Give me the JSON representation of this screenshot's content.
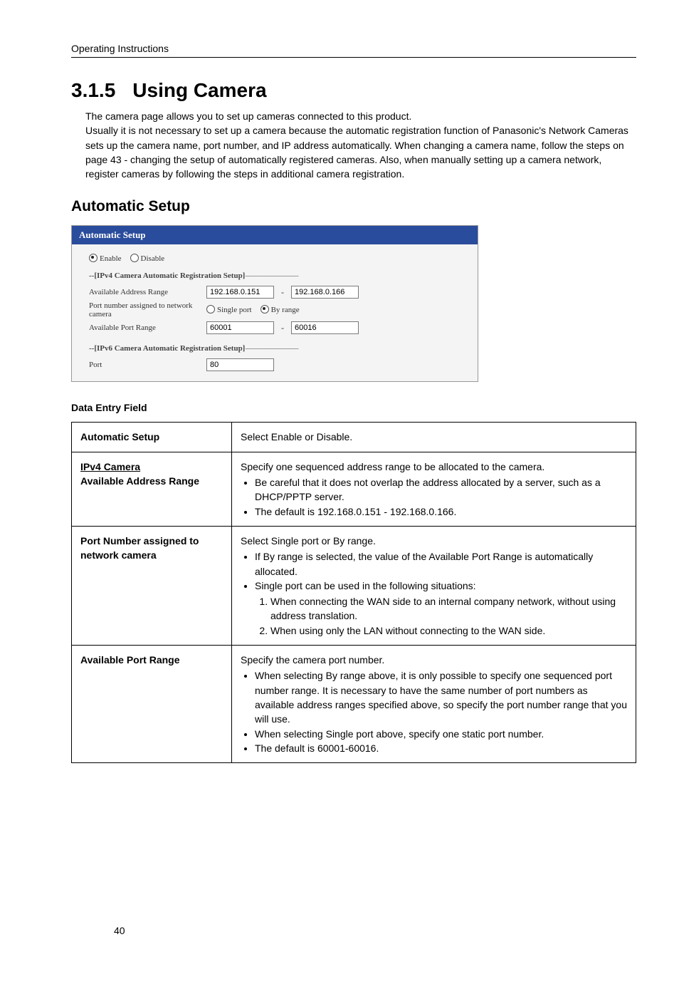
{
  "header": "Operating Instructions",
  "section_number": "3.1.5",
  "section_title": "Using Camera",
  "intro": "The camera page allows you to set up cameras connected to this product.\nUsually it is not necessary to set up a camera because the automatic registration function of Panasonic's Network Cameras sets up the camera name, port number, and IP address automatically. When changing a camera name, follow the steps on page 43 - changing the setup of automatically registered cameras. Also, when manually setting up a camera network, register cameras by following the steps in additional camera registration.",
  "subheading": "Automatic Setup",
  "screenshot": {
    "title": "Automatic Setup",
    "enable_label": "Enable",
    "disable_label": "Disable",
    "ipv4_legend": "--[IPv4 Camera Automatic Registration Setup]",
    "row_addr_label": "Available Address Range",
    "addr_from": "192.168.0.151",
    "addr_to": "192.168.0.166",
    "row_port_assign_label": "Port number assigned to network camera",
    "single_port_label": "Single port",
    "by_range_label": "By range",
    "row_port_range_label": "Available Port Range",
    "port_from": "60001",
    "port_to": "60016",
    "ipv6_legend": "--[IPv6 Camera Automatic Registration Setup]",
    "ipv6_port_label": "Port",
    "ipv6_port_value": "80"
  },
  "field_heading": "Data Entry Field",
  "table": {
    "r1c1": "Automatic Setup",
    "r1c2": "Select Enable or Disable.",
    "r2c1a": "IPv4 Camera",
    "r2c1b": "Available Address Range",
    "r2c2_lead": "Specify one sequenced address range to be allocated to the camera.",
    "r2c2_b1": "Be careful that it does not overlap the address allocated by a server, such as a DHCP/PPTP server.",
    "r2c2_b2": "The default is 192.168.0.151 - 192.168.0.166.",
    "r3c1a": "Port Number assigned to network camera",
    "r3c2_lead": "Select Single port or By range.",
    "r3c2_b1": "If By range is selected, the value of the Available Port Range is automatically allocated.",
    "r3c2_b2": "Single port can be used in the following situations:",
    "r3c2_n1": "When connecting the WAN side to an internal company network, without using address translation.",
    "r3c2_n2": "When using only the LAN without connecting to the WAN side.",
    "r4c1": "Available Port Range",
    "r4c2_lead": "Specify the camera port number.",
    "r4c2_b1": "When selecting By range above, it is only possible to specify one sequenced port number range. It is necessary to have the same number of port numbers as available address ranges specified above, so specify the port number range that you will use.",
    "r4c2_b2": "When selecting Single port above, specify one static port number.",
    "r4c2_b3": "The default is 60001-60016."
  },
  "page_number": "40"
}
